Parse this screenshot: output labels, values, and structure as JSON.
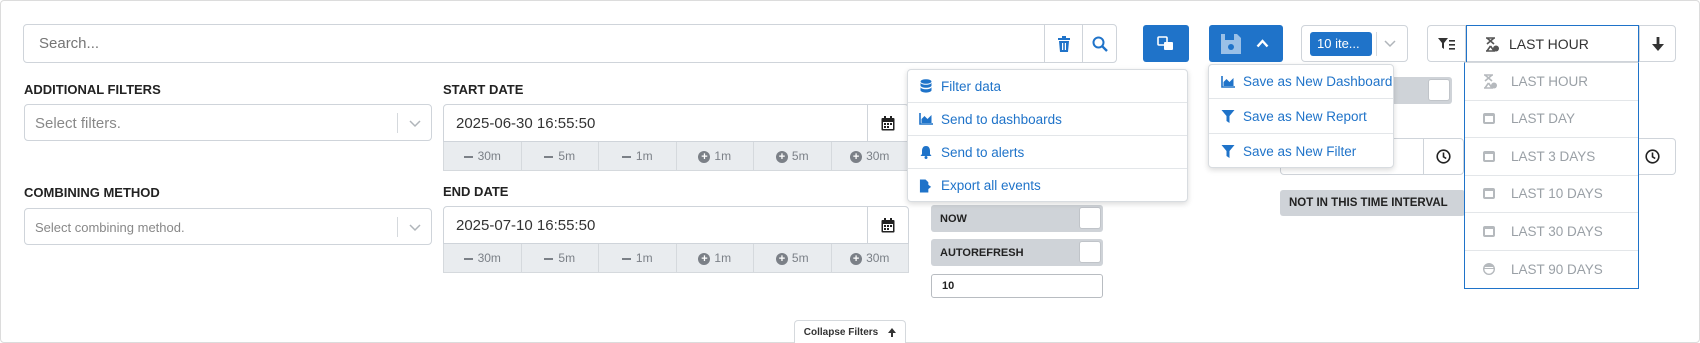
{
  "search": {
    "placeholder": "Search..."
  },
  "additional_filters": {
    "label": "ADDITIONAL FILTERS",
    "placeholder": "Select filters."
  },
  "combining_method": {
    "label": "COMBINING METHOD",
    "placeholder": "Select combining method."
  },
  "start_date": {
    "label": "START DATE",
    "value": "2025-06-30 16:55:50",
    "adjust": [
      "30m",
      "5m",
      "1m",
      "1m",
      "5m",
      "30m"
    ]
  },
  "end_date": {
    "label": "END DATE",
    "value": "2025-07-10 16:55:50",
    "adjust": [
      "30m",
      "5m",
      "1m",
      "1m",
      "5m",
      "30m"
    ]
  },
  "now_toggle": {
    "label": "NOW"
  },
  "autorefresh_toggle": {
    "label": "AUTOREFRESH"
  },
  "refresh_interval": {
    "value": "10"
  },
  "items_select": {
    "value": "10 ite..."
  },
  "export_menu": {
    "items": [
      "Filter data",
      "Send to dashboards",
      "Send to alerts",
      "Export all events"
    ]
  },
  "save_menu": {
    "items": [
      "Save as New Dashboard",
      "Save as New Report",
      "Save as New Filter"
    ]
  },
  "not_interval": {
    "label": "NOT IN THIS TIME INTERVAL"
  },
  "time_range": {
    "selected": "LAST HOUR",
    "options": [
      "LAST HOUR",
      "LAST DAY",
      "LAST 3 DAYS",
      "LAST 10 DAYS",
      "LAST 30 DAYS",
      "LAST 90 DAYS"
    ]
  },
  "collapse": {
    "label": "Collapse Filters"
  },
  "colors": {
    "accent": "#1f73c9",
    "toggle_bg": "#cfd3d8"
  }
}
